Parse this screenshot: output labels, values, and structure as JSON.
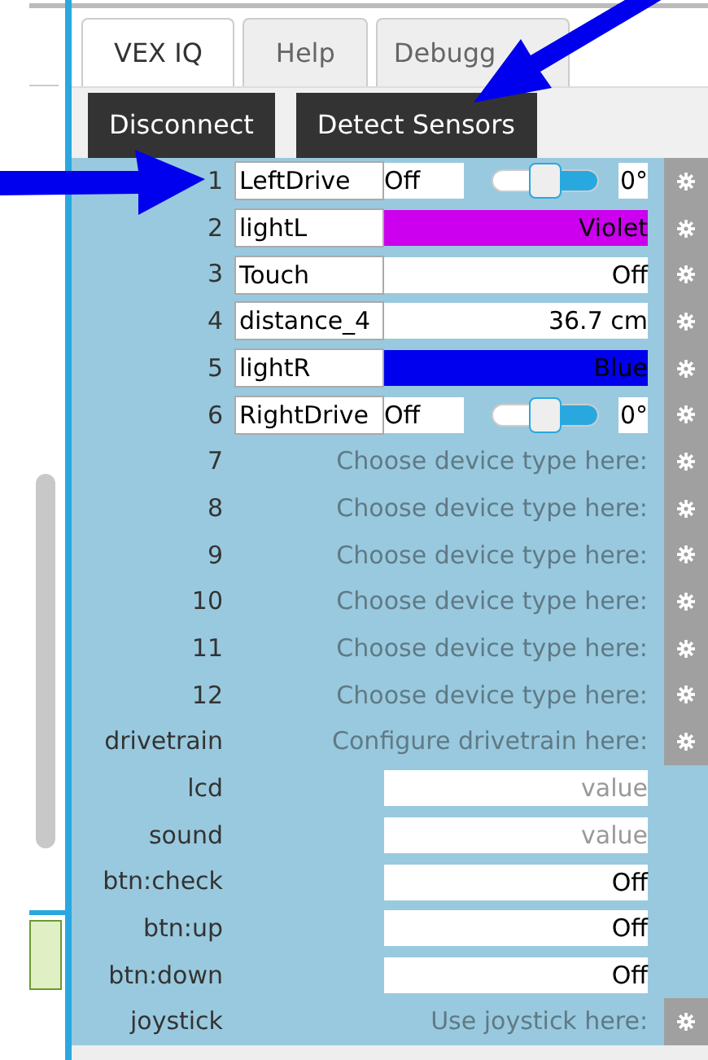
{
  "tabs": [
    {
      "label": "VEX IQ",
      "selected": true
    },
    {
      "label": "Help",
      "selected": false
    },
    {
      "label": "Debugg",
      "selected": false
    }
  ],
  "buttons": [
    "Disconnect",
    "Detect Sensors"
  ],
  "ports": [
    {
      "kind": "motor",
      "label": "1",
      "name": "LeftDrive",
      "value": "Off",
      "level": 0.5,
      "angle": "0°"
    },
    {
      "kind": "sensor",
      "label": "2",
      "name": "lightL",
      "value": "Violet",
      "color": "#cc00ee"
    },
    {
      "kind": "sensor",
      "label": "3",
      "name": "Touch",
      "value": "Off"
    },
    {
      "kind": "sensor",
      "label": "4",
      "name": "distance_4",
      "value": "36.7 cm"
    },
    {
      "kind": "sensor",
      "label": "5",
      "name": "lightR",
      "value": "Blue",
      "color": "#0000ee"
    },
    {
      "kind": "motor",
      "label": "6",
      "name": "RightDrive",
      "value": "Off",
      "level": 0.5,
      "angle": "0°"
    },
    {
      "kind": "empty",
      "label": "7",
      "placeholder": "Choose device type here:"
    },
    {
      "kind": "empty",
      "label": "8",
      "placeholder": "Choose device type here:"
    },
    {
      "kind": "empty",
      "label": "9",
      "placeholder": "Choose device type here:"
    },
    {
      "kind": "empty",
      "label": "10",
      "placeholder": "Choose device type here:"
    },
    {
      "kind": "empty",
      "label": "11",
      "placeholder": "Choose device type here:"
    },
    {
      "kind": "empty",
      "label": "12",
      "placeholder": "Choose device type here:"
    },
    {
      "kind": "empty",
      "label": "drivetrain",
      "placeholder": "Configure drivetrain here:"
    },
    {
      "kind": "field",
      "label": "lcd",
      "placeholder": "value"
    },
    {
      "kind": "field",
      "label": "sound",
      "placeholder": "value"
    },
    {
      "kind": "field",
      "label": "btn:check",
      "value": "Off"
    },
    {
      "kind": "field",
      "label": "btn:up",
      "value": "Off"
    },
    {
      "kind": "field",
      "label": "btn:down",
      "value": "Off"
    },
    {
      "kind": "empty",
      "label": "joystick",
      "placeholder": "Use joystick here:"
    }
  ]
}
